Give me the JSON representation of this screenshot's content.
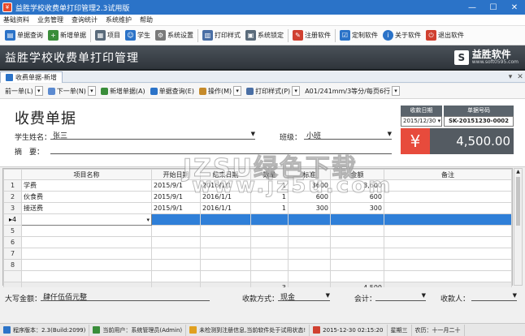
{
  "window": {
    "title": "益胜学校收费单打印管理2.3试用版",
    "icon": "app-icon"
  },
  "menu": [
    "基础资料",
    "业务管理",
    "查询统计",
    "系统维护",
    "帮助"
  ],
  "toolbar": [
    {
      "label": "单据查询",
      "icon": "document-search-icon",
      "color": "#2b73c8"
    },
    {
      "label": "新增单据",
      "icon": "new-document-icon",
      "color": "#3a8d3a"
    },
    {
      "label": "项目",
      "icon": "grid-icon",
      "color": "#5a6b7b"
    },
    {
      "label": "学生",
      "icon": "students-icon",
      "color": "#2b73c8"
    },
    {
      "label": "系统设置",
      "icon": "gear-icon",
      "color": "#7a7a7a"
    },
    {
      "label": "打印样式",
      "icon": "print-style-icon",
      "color": "#4a6fa5"
    },
    {
      "label": "系统锁定",
      "icon": "lock-icon",
      "color": "#5a6b7b"
    },
    {
      "label": "注册软件",
      "icon": "register-icon",
      "color": "#d04030"
    },
    {
      "label": "定制软件",
      "icon": "customize-icon",
      "color": "#2b73c8"
    },
    {
      "label": "关于软件",
      "icon": "info-icon",
      "color": "#2b73c8"
    },
    {
      "label": "退出软件",
      "icon": "exit-icon",
      "color": "#d04030"
    }
  ],
  "banner": {
    "title": "益胜学校收费单打印管理",
    "logo_text": "益胜软件",
    "logo_url": "www.soft0595.com"
  },
  "doc_tab": {
    "label": "收费单据-新增"
  },
  "doc_toolbar": {
    "prev": "前一单(L)",
    "next": "下一单(N)",
    "new": "新增单据(A)",
    "query": "单据查询(E)",
    "action": "操作(M)",
    "print_style": "打印样式(P)",
    "paper": "A01/241mm/3等分/每页6行"
  },
  "form": {
    "title": "收费单据",
    "student_label": "学生姓名：",
    "student_value": "张三",
    "class_label": "班级：",
    "class_value": "小班",
    "summary_label": "摘　要：",
    "summary_value": "",
    "date_label": "收款日期",
    "date_value": "2015/12/30",
    "number_label": "单据号码",
    "number_value": "SK-20151230-0002",
    "currency_symbol": "¥",
    "amount": "4,500.00"
  },
  "grid": {
    "headers": [
      "",
      "项目名称",
      "开始日期",
      "结束日期",
      "数量",
      "标准",
      "金额",
      "备注"
    ],
    "rows": [
      {
        "no": "1",
        "item": "学费",
        "start": "2015/9/1",
        "end": "2016/1/1",
        "qty": "1",
        "std": "3600",
        "amount": "3,600",
        "note": ""
      },
      {
        "no": "2",
        "item": "伙食费",
        "start": "2015/9/1",
        "end": "2016/1/1",
        "qty": "1",
        "std": "600",
        "amount": "600",
        "note": ""
      },
      {
        "no": "3",
        "item": "接送费",
        "start": "2015/9/1",
        "end": "2016/1/1",
        "qty": "1",
        "std": "300",
        "amount": "300",
        "note": ""
      },
      {
        "no": "4",
        "item": "",
        "start": "",
        "end": "",
        "qty": "",
        "std": "",
        "amount": "",
        "note": ""
      },
      {
        "no": "5",
        "item": "",
        "start": "",
        "end": "",
        "qty": "",
        "std": "",
        "amount": "",
        "note": ""
      },
      {
        "no": "6",
        "item": "",
        "start": "",
        "end": "",
        "qty": "",
        "std": "",
        "amount": "",
        "note": ""
      },
      {
        "no": "7",
        "item": "",
        "start": "",
        "end": "",
        "qty": "",
        "std": "",
        "amount": "",
        "note": ""
      },
      {
        "no": "8",
        "item": "",
        "start": "",
        "end": "",
        "qty": "",
        "std": "",
        "amount": "",
        "note": ""
      }
    ],
    "total_qty": "3",
    "total_amount": "4,500"
  },
  "footer": {
    "capital_label": "大写金额：",
    "capital_value": "肆仟伍佰元整",
    "method_label": "收款方式：",
    "method_value": "现金",
    "accountant_label": "会计：",
    "accountant_value": "",
    "payee_label": "收款人：",
    "payee_value": ""
  },
  "status": {
    "version": "程序版本：2.3(Build:2099)",
    "user": "当前用户：系统管理员(Admin)",
    "reg": "未检测到注册信息,当前软件处于试用状态!",
    "datetime": "2015-12-30 02:15:20",
    "weekday": "星期三",
    "lunar": "农历：十一月二十"
  },
  "watermark": {
    "line1": "JZSU绿色下载",
    "line2": "www.jz5u.com"
  },
  "colors": {
    "titlebar": "#2b73c8",
    "banner": "#3a4047",
    "amount_bg": "#545b62",
    "currency_bg": "#e74b3c",
    "selected_row": "#2f7fd8"
  }
}
